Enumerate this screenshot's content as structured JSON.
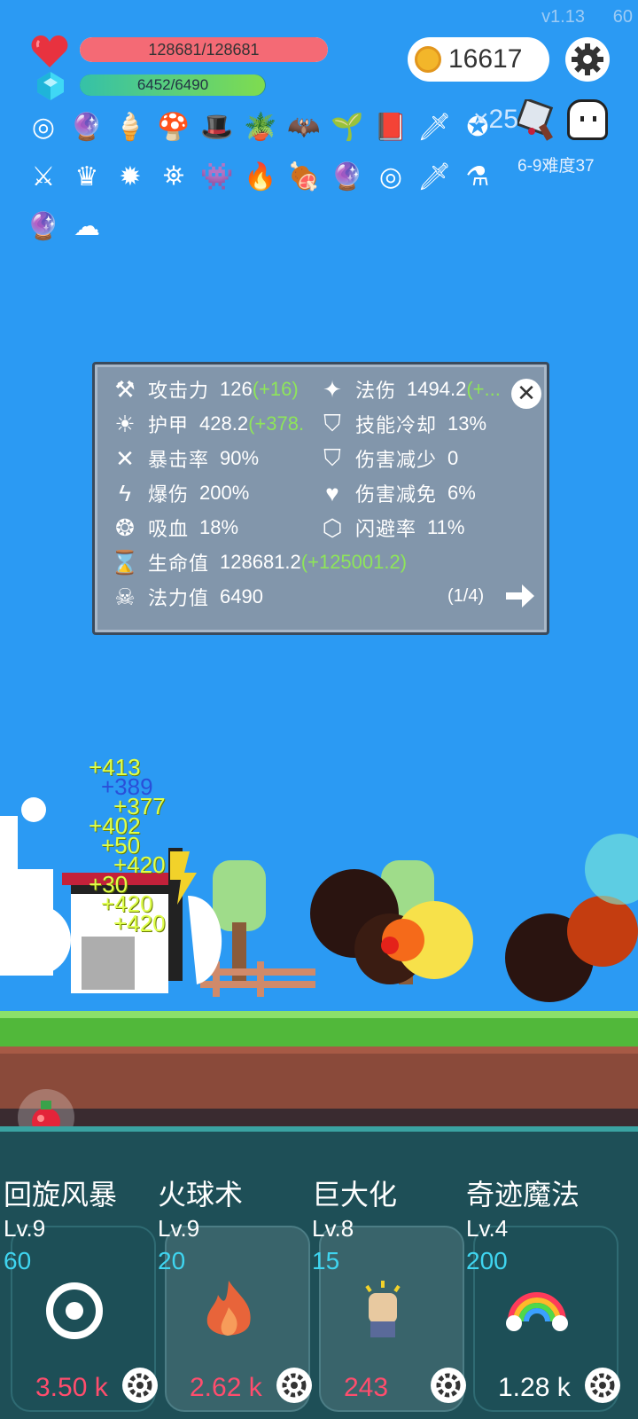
{
  "header": {
    "version": "v1.13",
    "fps": "60",
    "hp_text_current": "128681",
    "hp_text_max": "128681",
    "hp_fraction": 1.0,
    "mp_text": "6452/6490",
    "mp_fraction": 0.994,
    "coins": "16617",
    "item_extra_count": "25",
    "difficulty": "6-9难度37"
  },
  "items": [
    "ring-icon",
    "crystal-ball-icon",
    "ice-cream-icon",
    "mushroom-icon",
    "wizard-hat-icon",
    "potted-plant-icon",
    "bat-icon",
    "sapling-icon",
    "spellbook-icon",
    "dagger-icon",
    "bubble-icon",
    "sword-icon",
    "crown-icon",
    "spike-ball-icon",
    "mortar-icon",
    "slime-icon",
    "torch-icon",
    "meat-icon",
    "crystal-ball-icon",
    "ring-icon",
    "dagger-icon",
    "green-potion-icon",
    "crystal-ball-icon",
    "wing-icon"
  ],
  "stats": {
    "left": [
      {
        "icon": "axe-icon",
        "label": "攻击力",
        "value": "126",
        "bonus": "(+16)"
      },
      {
        "icon": "sun-icon",
        "label": "护甲",
        "value": "428.2",
        "bonus": "(+378."
      },
      {
        "icon": "crossed-swords-icon",
        "label": "暴击率",
        "value": "90%",
        "bonus": ""
      },
      {
        "icon": "lightning-icon",
        "label": "爆伤",
        "value": "200%",
        "bonus": ""
      },
      {
        "icon": "vampire-ring-icon",
        "label": "吸血",
        "value": "18%",
        "bonus": ""
      },
      {
        "icon": "hourglass-icon",
        "label": "生命值",
        "value": "128681.2",
        "bonus": "(+125001.2)"
      },
      {
        "icon": "demon-skull-icon",
        "label": "法力值",
        "value": "6490",
        "bonus": ""
      }
    ],
    "right": [
      {
        "icon": "magic-wand-icon",
        "label": "法伤",
        "value": "1494.2",
        "bonus": "(+..."
      },
      {
        "icon": "shield-cooldown-icon",
        "label": "技能冷却",
        "value": "13%",
        "bonus": ""
      },
      {
        "icon": "shield-heart-icon",
        "label": "伤害减少",
        "value": "0",
        "bonus": ""
      },
      {
        "icon": "heart-icon",
        "label": "伤害减免",
        "value": "6%",
        "bonus": ""
      },
      {
        "icon": "dodge-icon",
        "label": "闪避率",
        "value": "11%",
        "bonus": ""
      }
    ],
    "page": "(1/4)"
  },
  "damage_numbers": [
    "+413",
    "+389",
    "+377",
    "+402",
    "+50",
    "+420",
    "+30",
    "+420",
    "+420"
  ],
  "skills": [
    {
      "name": "回旋风暴",
      "level": "Lv.9",
      "cost": "60",
      "price": "3.50 k",
      "icon": "whirlwind-icon"
    },
    {
      "name": "火球术",
      "level": "Lv.9",
      "cost": "20",
      "price": "2.62 k",
      "icon": "fire-icon"
    },
    {
      "name": "巨大化",
      "level": "Lv.8",
      "cost": "15",
      "price": "243",
      "icon": "fist-icon"
    },
    {
      "name": "奇迹魔法",
      "level": "Lv.4",
      "cost": "200",
      "price": "1.28 k",
      "icon": "rainbow-icon"
    }
  ],
  "colors": {
    "sky": "#2b9af3",
    "hp": "#f46a75",
    "bonus": "#8ee55a",
    "price_red": "#ff4d6d",
    "cost_cyan": "#3fd5f0"
  }
}
